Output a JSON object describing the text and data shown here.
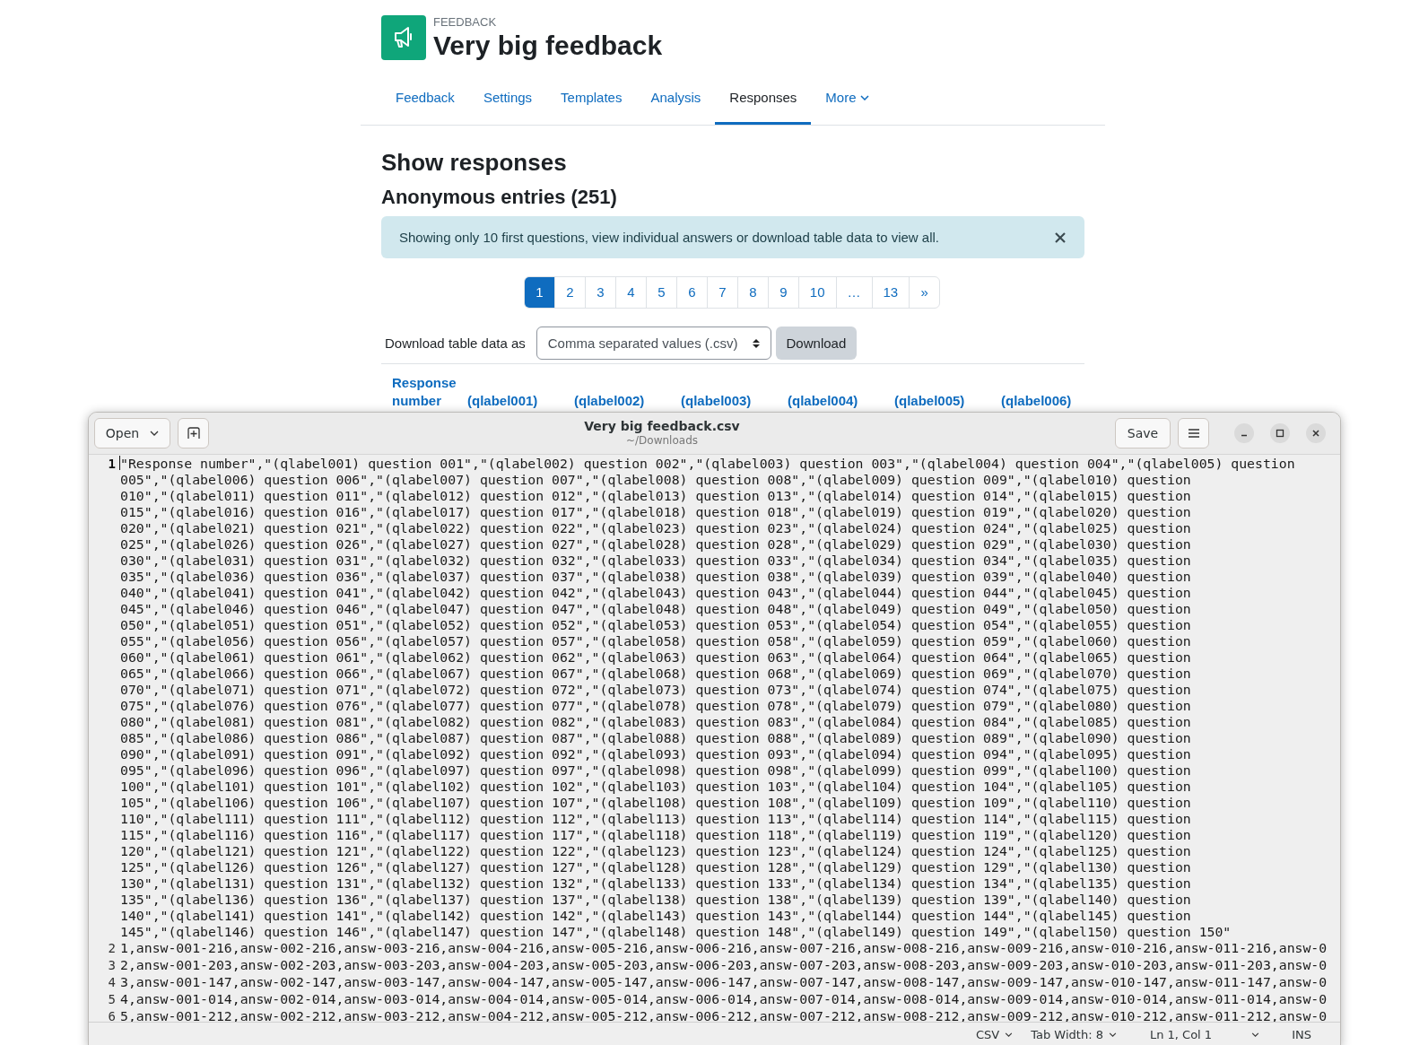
{
  "page": {
    "module_label": "FEEDBACK",
    "title": "Very big feedback",
    "tabs": [
      {
        "label": "Feedback",
        "selected": false,
        "kind": "link"
      },
      {
        "label": "Settings",
        "selected": false,
        "kind": "link"
      },
      {
        "label": "Templates",
        "selected": false,
        "kind": "link"
      },
      {
        "label": "Analysis",
        "selected": false,
        "kind": "link"
      },
      {
        "label": "Responses",
        "selected": true,
        "kind": "link"
      },
      {
        "label": "More",
        "selected": false,
        "kind": "menu"
      }
    ],
    "heading": "Show responses",
    "subheading": "Anonymous entries (251)",
    "alert": {
      "text": "Showing only 10 first questions, view individual answers or download table data to view all."
    },
    "pagination": [
      {
        "label": "1",
        "selected": true
      },
      {
        "label": "2",
        "selected": false
      },
      {
        "label": "3",
        "selected": false
      },
      {
        "label": "4",
        "selected": false
      },
      {
        "label": "5",
        "selected": false
      },
      {
        "label": "6",
        "selected": false
      },
      {
        "label": "7",
        "selected": false
      },
      {
        "label": "8",
        "selected": false
      },
      {
        "label": "9",
        "selected": false
      },
      {
        "label": "10",
        "selected": false
      },
      {
        "label": "…",
        "selected": false
      },
      {
        "label": "13",
        "selected": false
      },
      {
        "label": "»",
        "selected": false
      }
    ],
    "download": {
      "label": "Download table data as",
      "format": "Comma separated values (.csv)",
      "button": "Download"
    },
    "table": {
      "columns": [
        "Response number",
        "(qlabel001)",
        "(qlabel002)",
        "(qlabel003)",
        "(qlabel004)",
        "(qlabel005)",
        "(qlabel006)"
      ]
    }
  },
  "editor": {
    "open_button": "Open",
    "title": "Very big feedback.csv",
    "path": "~/Downloads",
    "save_button": "Save",
    "lines": [
      {
        "number": "1",
        "current": true,
        "rows": [
          "\"Response number\",\"(qlabel001) question 001\",\"(qlabel002) question 002\",\"(qlabel003) question 003\",\"(qlabel004) question 004\",\"(qlabel005) question",
          "005\",\"(qlabel006) question 006\",\"(qlabel007) question 007\",\"(qlabel008) question 008\",\"(qlabel009) question 009\",\"(qlabel010) question",
          "010\",\"(qlabel011) question 011\",\"(qlabel012) question 012\",\"(qlabel013) question 013\",\"(qlabel014) question 014\",\"(qlabel015) question",
          "015\",\"(qlabel016) question 016\",\"(qlabel017) question 017\",\"(qlabel018) question 018\",\"(qlabel019) question 019\",\"(qlabel020) question",
          "020\",\"(qlabel021) question 021\",\"(qlabel022) question 022\",\"(qlabel023) question 023\",\"(qlabel024) question 024\",\"(qlabel025) question",
          "025\",\"(qlabel026) question 026\",\"(qlabel027) question 027\",\"(qlabel028) question 028\",\"(qlabel029) question 029\",\"(qlabel030) question",
          "030\",\"(qlabel031) question 031\",\"(qlabel032) question 032\",\"(qlabel033) question 033\",\"(qlabel034) question 034\",\"(qlabel035) question",
          "035\",\"(qlabel036) question 036\",\"(qlabel037) question 037\",\"(qlabel038) question 038\",\"(qlabel039) question 039\",\"(qlabel040) question",
          "040\",\"(qlabel041) question 041\",\"(qlabel042) question 042\",\"(qlabel043) question 043\",\"(qlabel044) question 044\",\"(qlabel045) question",
          "045\",\"(qlabel046) question 046\",\"(qlabel047) question 047\",\"(qlabel048) question 048\",\"(qlabel049) question 049\",\"(qlabel050) question",
          "050\",\"(qlabel051) question 051\",\"(qlabel052) question 052\",\"(qlabel053) question 053\",\"(qlabel054) question 054\",\"(qlabel055) question",
          "055\",\"(qlabel056) question 056\",\"(qlabel057) question 057\",\"(qlabel058) question 058\",\"(qlabel059) question 059\",\"(qlabel060) question",
          "060\",\"(qlabel061) question 061\",\"(qlabel062) question 062\",\"(qlabel063) question 063\",\"(qlabel064) question 064\",\"(qlabel065) question",
          "065\",\"(qlabel066) question 066\",\"(qlabel067) question 067\",\"(qlabel068) question 068\",\"(qlabel069) question 069\",\"(qlabel070) question",
          "070\",\"(qlabel071) question 071\",\"(qlabel072) question 072\",\"(qlabel073) question 073\",\"(qlabel074) question 074\",\"(qlabel075) question",
          "075\",\"(qlabel076) question 076\",\"(qlabel077) question 077\",\"(qlabel078) question 078\",\"(qlabel079) question 079\",\"(qlabel080) question",
          "080\",\"(qlabel081) question 081\",\"(qlabel082) question 082\",\"(qlabel083) question 083\",\"(qlabel084) question 084\",\"(qlabel085) question",
          "085\",\"(qlabel086) question 086\",\"(qlabel087) question 087\",\"(qlabel088) question 088\",\"(qlabel089) question 089\",\"(qlabel090) question",
          "090\",\"(qlabel091) question 091\",\"(qlabel092) question 092\",\"(qlabel093) question 093\",\"(qlabel094) question 094\",\"(qlabel095) question",
          "095\",\"(qlabel096) question 096\",\"(qlabel097) question 097\",\"(qlabel098) question 098\",\"(qlabel099) question 099\",\"(qlabel100) question",
          "100\",\"(qlabel101) question 101\",\"(qlabel102) question 102\",\"(qlabel103) question 103\",\"(qlabel104) question 104\",\"(qlabel105) question",
          "105\",\"(qlabel106) question 106\",\"(qlabel107) question 107\",\"(qlabel108) question 108\",\"(qlabel109) question 109\",\"(qlabel110) question",
          "110\",\"(qlabel111) question 111\",\"(qlabel112) question 112\",\"(qlabel113) question 113\",\"(qlabel114) question 114\",\"(qlabel115) question",
          "115\",\"(qlabel116) question 116\",\"(qlabel117) question 117\",\"(qlabel118) question 118\",\"(qlabel119) question 119\",\"(qlabel120) question",
          "120\",\"(qlabel121) question 121\",\"(qlabel122) question 122\",\"(qlabel123) question 123\",\"(qlabel124) question 124\",\"(qlabel125) question",
          "125\",\"(qlabel126) question 126\",\"(qlabel127) question 127\",\"(qlabel128) question 128\",\"(qlabel129) question 129\",\"(qlabel130) question",
          "130\",\"(qlabel131) question 131\",\"(qlabel132) question 132\",\"(qlabel133) question 133\",\"(qlabel134) question 134\",\"(qlabel135) question",
          "135\",\"(qlabel136) question 136\",\"(qlabel137) question 137\",\"(qlabel138) question 138\",\"(qlabel139) question 139\",\"(qlabel140) question",
          "140\",\"(qlabel141) question 141\",\"(qlabel142) question 142\",\"(qlabel143) question 143\",\"(qlabel144) question 144\",\"(qlabel145) question",
          "145\",\"(qlabel146) question 146\",\"(qlabel147) question 147\",\"(qlabel148) question 148\",\"(qlabel149) question 149\",\"(qlabel150) question 150\""
        ]
      },
      {
        "number": "2",
        "current": false,
        "rows": [
          "1,answ-001-216,answ-002-216,answ-003-216,answ-004-216,answ-005-216,answ-006-216,answ-007-216,answ-008-216,answ-009-216,answ-010-216,answ-011-216,answ-0"
        ]
      },
      {
        "number": "3",
        "current": false,
        "rows": [
          "2,answ-001-203,answ-002-203,answ-003-203,answ-004-203,answ-005-203,answ-006-203,answ-007-203,answ-008-203,answ-009-203,answ-010-203,answ-011-203,answ-0"
        ]
      },
      {
        "number": "4",
        "current": false,
        "rows": [
          "3,answ-001-147,answ-002-147,answ-003-147,answ-004-147,answ-005-147,answ-006-147,answ-007-147,answ-008-147,answ-009-147,answ-010-147,answ-011-147,answ-0"
        ]
      },
      {
        "number": "5",
        "current": false,
        "rows": [
          "4,answ-001-014,answ-002-014,answ-003-014,answ-004-014,answ-005-014,answ-006-014,answ-007-014,answ-008-014,answ-009-014,answ-010-014,answ-011-014,answ-0"
        ]
      },
      {
        "number": "6",
        "current": false,
        "rows": [
          "5,answ-001-212,answ-002-212,answ-003-212,answ-004-212,answ-005-212,answ-006-212,answ-007-212,answ-008-212,answ-009-212,answ-010-212,answ-011-212,answ-0"
        ]
      }
    ],
    "status_bar": {
      "language": "CSV",
      "tab_width": "Tab Width: 8",
      "position": "Ln 1, Col 1",
      "mode": "INS"
    }
  }
}
